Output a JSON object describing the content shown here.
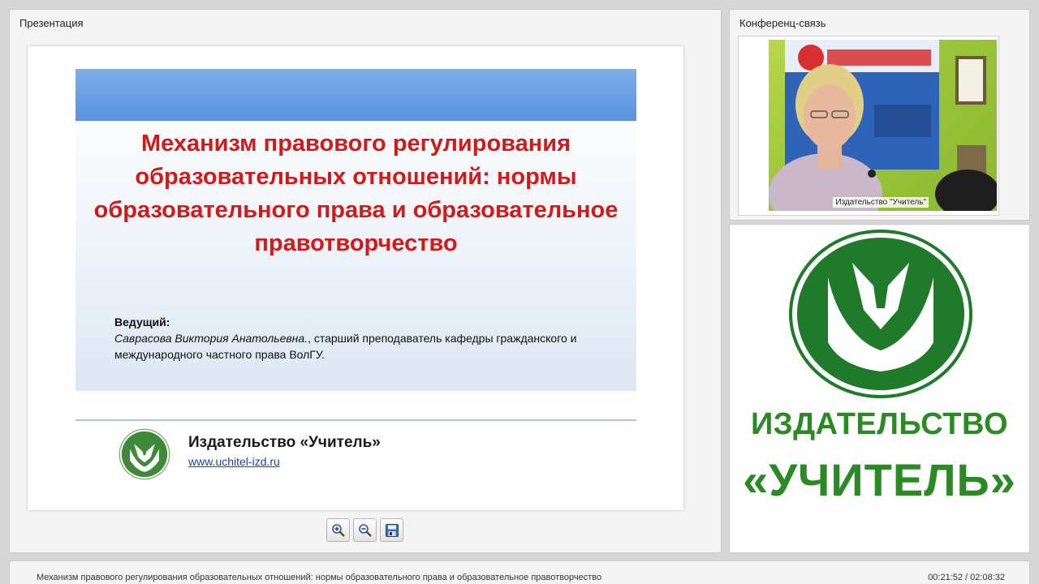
{
  "presentation": {
    "panel_title": "Презентация",
    "slide": {
      "title": "Механизм правового регулирования образовательных отношений: нормы образовательного права и образовательное правотворчество",
      "host_label": "Ведущий:",
      "host_name": "Саврасова Виктория Анатольевна.",
      "host_role": ", старший преподаватель кафедры гражданского и международного частного права ВолГУ.",
      "publisher": "Издательство «Учитель»",
      "url": "www.uchitel-izd.ru"
    },
    "toolbar": {
      "zoom_in_icon": "zoom-in-icon",
      "zoom_out_icon": "zoom-out-icon",
      "save_icon": "save-icon"
    }
  },
  "conference": {
    "panel_title": "Конференц-связь",
    "video_label": "Издательство \"Учитель\""
  },
  "logo_panel": {
    "word1": "ИЗДАТЕЛЬСТВО",
    "word2": "«УЧИТЕЛЬ»"
  },
  "bottom_bar": {
    "title": "Механизм правового регулирования образовательных отношений: нормы образовательного права и образовательное правотворчество",
    "time": "00:21:52 / 02:08:32"
  },
  "colors": {
    "brand_green": "#2b8a24",
    "title_red": "#d11a1a",
    "header_blue": "#5a92de"
  }
}
